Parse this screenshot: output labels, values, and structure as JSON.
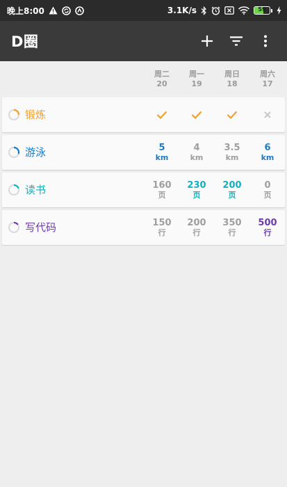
{
  "status_bar": {
    "time": "晚上8:00",
    "speed": "3.1K/s",
    "battery": "59",
    "battery_level": 0.59,
    "icons_left": [
      "warning-icon",
      "sync-icon",
      "vpn-icon"
    ],
    "icons_right": [
      "bluetooth-icon",
      "alarm-icon",
      "sim-off-icon",
      "wifi-icon",
      "battery-icon",
      "charging-icon"
    ]
  },
  "app_bar": {
    "title": "D圈",
    "actions": [
      "add-icon",
      "filter-icon",
      "more-vert-icon"
    ]
  },
  "days": [
    {
      "weekday": "周二",
      "date": "20"
    },
    {
      "weekday": "周一",
      "date": "19"
    },
    {
      "weekday": "周日",
      "date": "18"
    },
    {
      "weekday": "周六",
      "date": "17"
    }
  ],
  "colors": {
    "exercise": "#f0a02c",
    "swim": "#1e7bc0",
    "read": "#13b0be",
    "code": "#6c3ca8",
    "inactive": "#9e9e9e"
  },
  "habits": [
    {
      "name": "锻炼",
      "color": "#f0a02c",
      "progress": 0.25,
      "cells": [
        {
          "type": "check",
          "done": true
        },
        {
          "type": "check",
          "done": true
        },
        {
          "type": "check",
          "done": true
        },
        {
          "type": "cross",
          "done": false
        }
      ]
    },
    {
      "name": "游泳",
      "color": "#1e7bc0",
      "progress": 0.3,
      "cells": [
        {
          "value": "5",
          "unit": "km",
          "done": true
        },
        {
          "value": "4",
          "unit": "km",
          "done": false
        },
        {
          "value": "3.5",
          "unit": "km",
          "done": false
        },
        {
          "value": "6",
          "unit": "km",
          "done": true
        }
      ]
    },
    {
      "name": "读书",
      "color": "#13b0be",
      "progress": 0.2,
      "cells": [
        {
          "value": "160",
          "unit": "页",
          "done": false
        },
        {
          "value": "230",
          "unit": "页",
          "done": true
        },
        {
          "value": "200",
          "unit": "页",
          "done": true
        },
        {
          "value": "0",
          "unit": "页",
          "done": false
        }
      ]
    },
    {
      "name": "写代码",
      "color": "#6c3ca8",
      "progress": 0.15,
      "cells": [
        {
          "value": "150",
          "unit": "行",
          "done": false
        },
        {
          "value": "200",
          "unit": "行",
          "done": false
        },
        {
          "value": "350",
          "unit": "行",
          "done": false
        },
        {
          "value": "500",
          "unit": "行",
          "done": true
        }
      ]
    }
  ]
}
